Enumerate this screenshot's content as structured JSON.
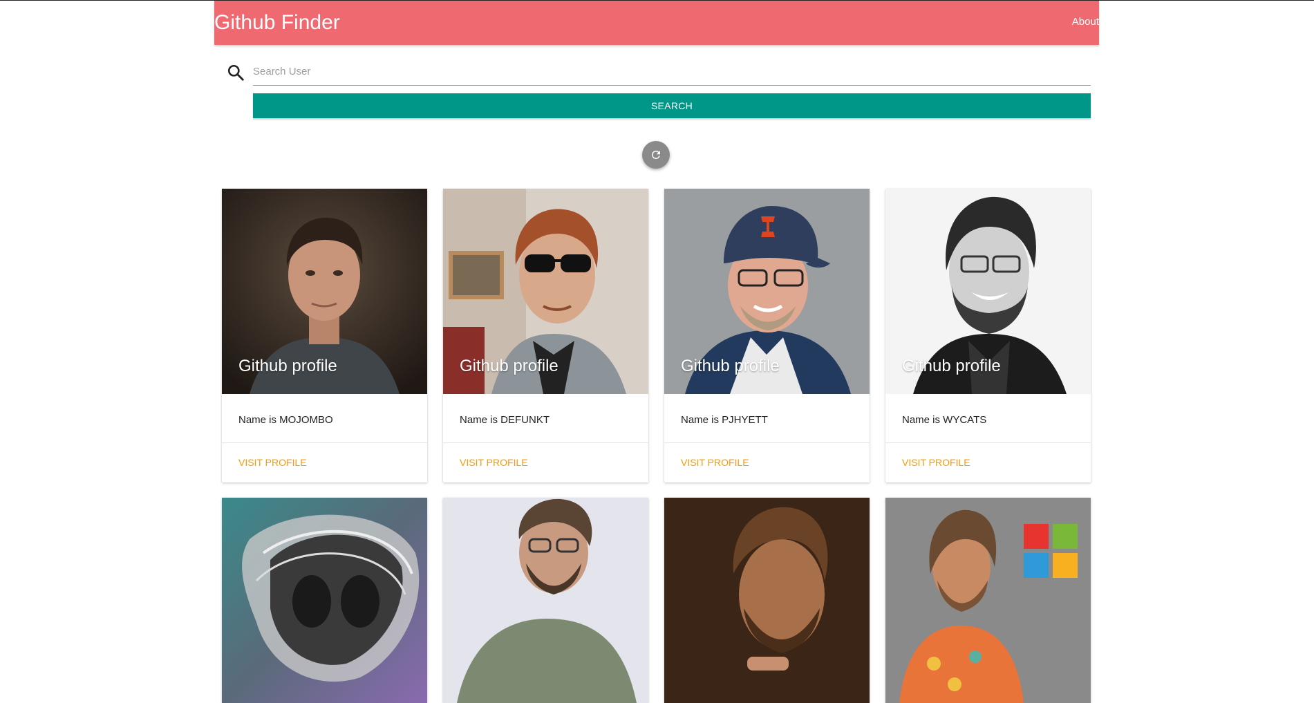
{
  "navbar": {
    "brand": "Github Finder",
    "about_label": "About",
    "color": "#ef6a70"
  },
  "search": {
    "icon": "search-icon",
    "placeholder": "Search User",
    "value": "",
    "button_label": "SEARCH",
    "button_color": "#009688"
  },
  "refresh": {
    "icon": "refresh-icon",
    "color": "#8a8a8a"
  },
  "cards": [
    {
      "title": "Github profile",
      "name_text": "Name is MOJOMBO",
      "action": "VISIT PROFILE"
    },
    {
      "title": "Github profile",
      "name_text": "Name is DEFUNKT",
      "action": "VISIT PROFILE"
    },
    {
      "title": "Github profile",
      "name_text": "Name is PJHYETT",
      "action": "VISIT PROFILE"
    },
    {
      "title": "Github profile",
      "name_text": "Name is WYCATS",
      "action": "VISIT PROFILE"
    },
    {
      "title": "",
      "name_text": "",
      "action": ""
    },
    {
      "title": "",
      "name_text": "",
      "action": ""
    },
    {
      "title": "",
      "name_text": "",
      "action": ""
    },
    {
      "title": "",
      "name_text": "",
      "action": ""
    }
  ],
  "colors": {
    "action_link": "#ff9800"
  }
}
